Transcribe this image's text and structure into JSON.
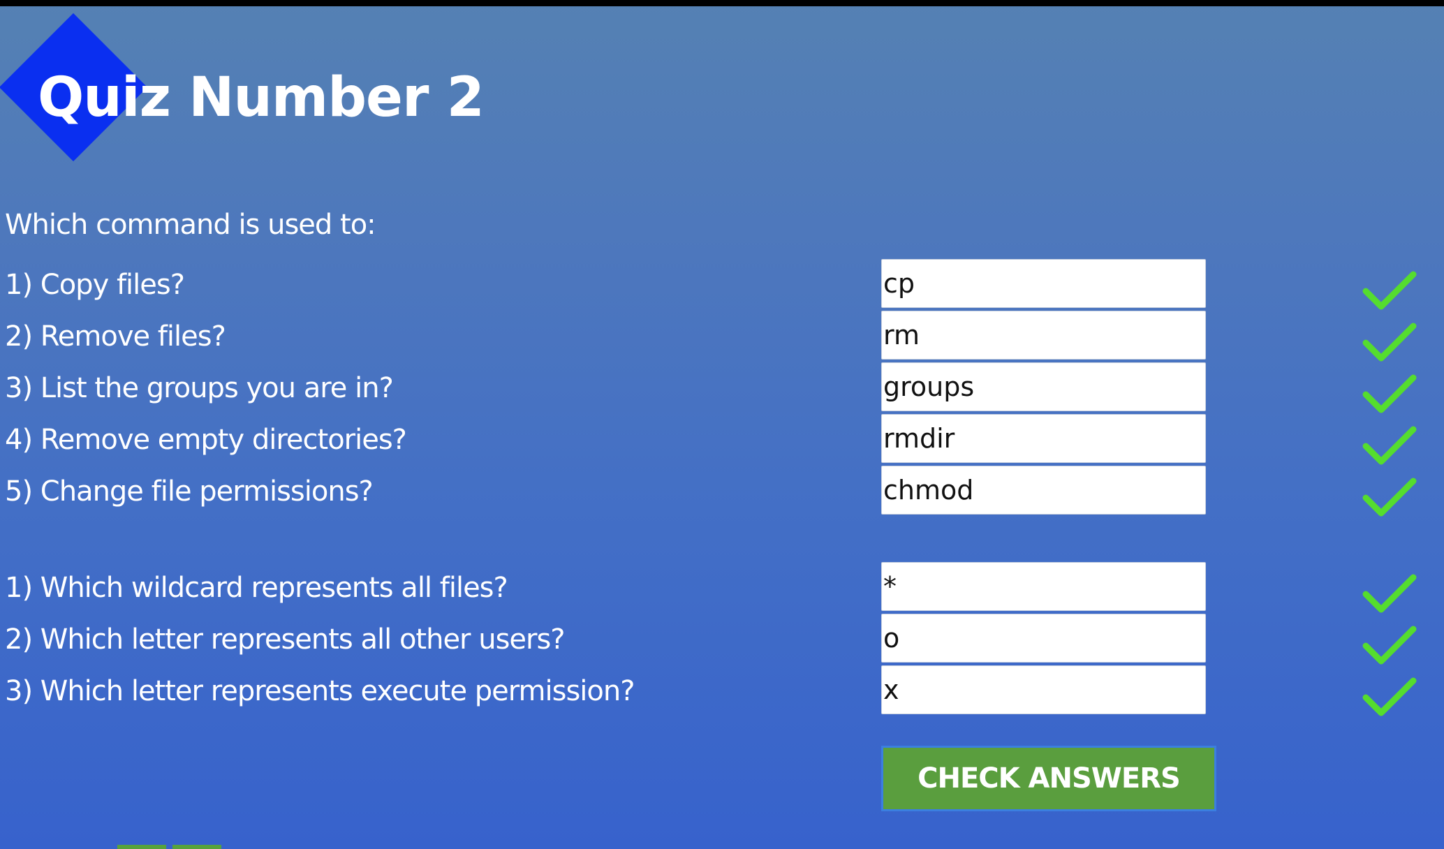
{
  "quiz": {
    "title": "Quiz Number 2",
    "intro": "Which command is used to:"
  },
  "section1": {
    "questions": [
      {
        "label": "1) Copy files?",
        "answer": "cp",
        "correct": true
      },
      {
        "label": "2) Remove files?",
        "answer": "rm",
        "correct": true
      },
      {
        "label": "3) List the groups you are in?",
        "answer": "groups",
        "correct": true
      },
      {
        "label": "4) Remove empty directories?",
        "answer": "rmdir",
        "correct": true
      },
      {
        "label": "5) Change file permissions?",
        "answer": "chmod",
        "correct": true
      }
    ]
  },
  "section2": {
    "questions": [
      {
        "label": "1) Which wildcard represents all files?",
        "answer": "*",
        "correct": true
      },
      {
        "label": "2) Which letter represents all other users?",
        "answer": "o",
        "correct": true
      },
      {
        "label": "3) Which letter represents execute permission?",
        "answer": "x",
        "correct": true
      }
    ]
  },
  "actions": {
    "check_label": "CHECK ANSWERS"
  },
  "icons": {
    "logo": "diamond-logo-icon",
    "correct": "checkmark-icon"
  },
  "colors": {
    "background_top": "#5581b3",
    "background_bottom": "#3762cc",
    "logo": "#0a2ff0",
    "checkmark": "#55dd2e",
    "button": "#5a9e3e",
    "button_border": "#3b7fe0"
  }
}
